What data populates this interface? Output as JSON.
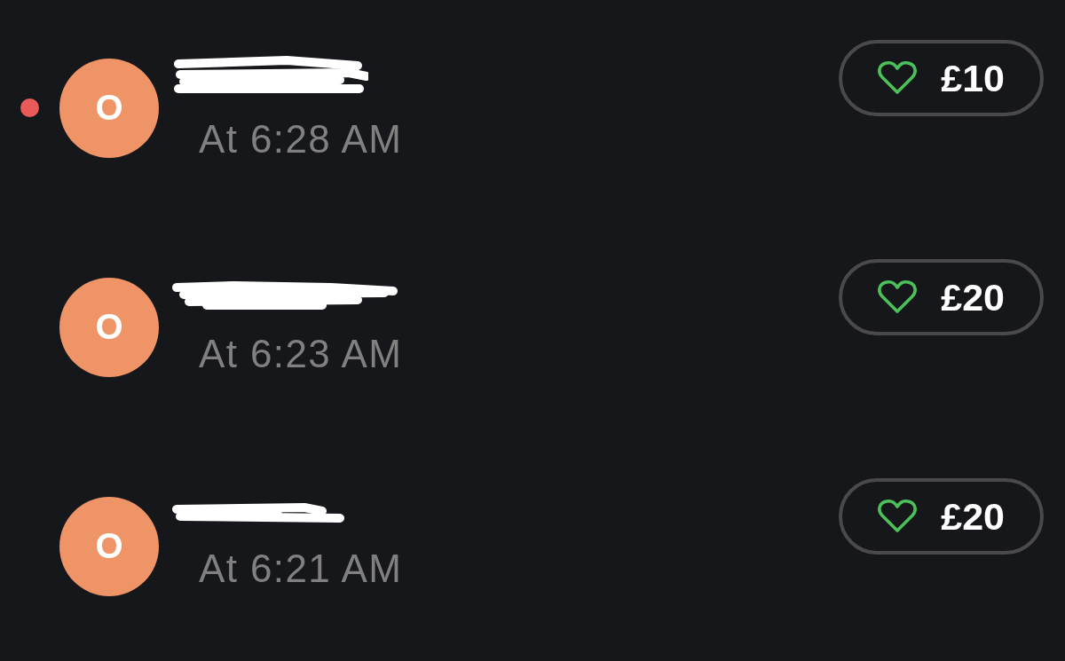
{
  "activity": [
    {
      "unread": true,
      "avatar_initial": "O",
      "time": "At 6:28 AM",
      "amount": "£10",
      "liked": false
    },
    {
      "unread": false,
      "avatar_initial": "O",
      "time": "At 6:23 AM",
      "amount": "£20",
      "liked": false
    },
    {
      "unread": false,
      "avatar_initial": "O",
      "time": "At 6:21 AM",
      "amount": "£20",
      "liked": false
    }
  ]
}
